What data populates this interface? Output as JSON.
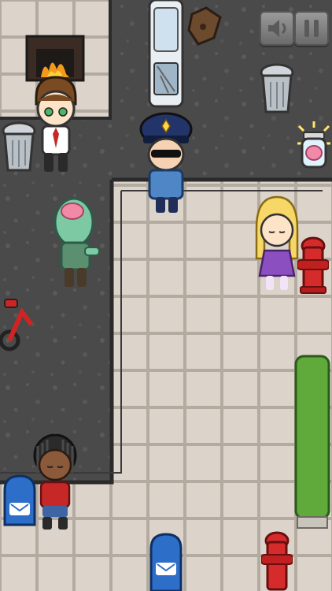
{
  "screen": {
    "controls": {
      "sound_button": {
        "icon": "speaker-muted-icon"
      },
      "pause_button": {
        "icon": "pause-icon"
      }
    },
    "characters": [
      {
        "role": "police-officer",
        "state": "active"
      },
      {
        "role": "businessman",
        "state": "idle"
      },
      {
        "role": "zombie",
        "state": "wandering"
      },
      {
        "role": "blonde-girl",
        "state": "asleep"
      },
      {
        "role": "braided-boy",
        "state": "asleep"
      }
    ],
    "items": [
      {
        "name": "trash-can"
      },
      {
        "name": "trash-can"
      },
      {
        "name": "brain-jar",
        "state": "sparkling"
      },
      {
        "name": "fire-hydrant"
      },
      {
        "name": "fire-hydrant"
      },
      {
        "name": "mailbox"
      },
      {
        "name": "mailbox"
      },
      {
        "name": "tricycle"
      },
      {
        "name": "hedge"
      },
      {
        "name": "parked-van"
      },
      {
        "name": "fireplace"
      },
      {
        "name": "sewer-grate"
      }
    ]
  },
  "colors": {
    "asphalt": "#4a4a4a",
    "tile": "#d8d0c6",
    "tile_line": "#b3aaa0",
    "wall": "#2a2a2a",
    "hydrant": "#d62b2b",
    "mailbox": "#2d6ec9",
    "hedge": "#5faa3a"
  }
}
